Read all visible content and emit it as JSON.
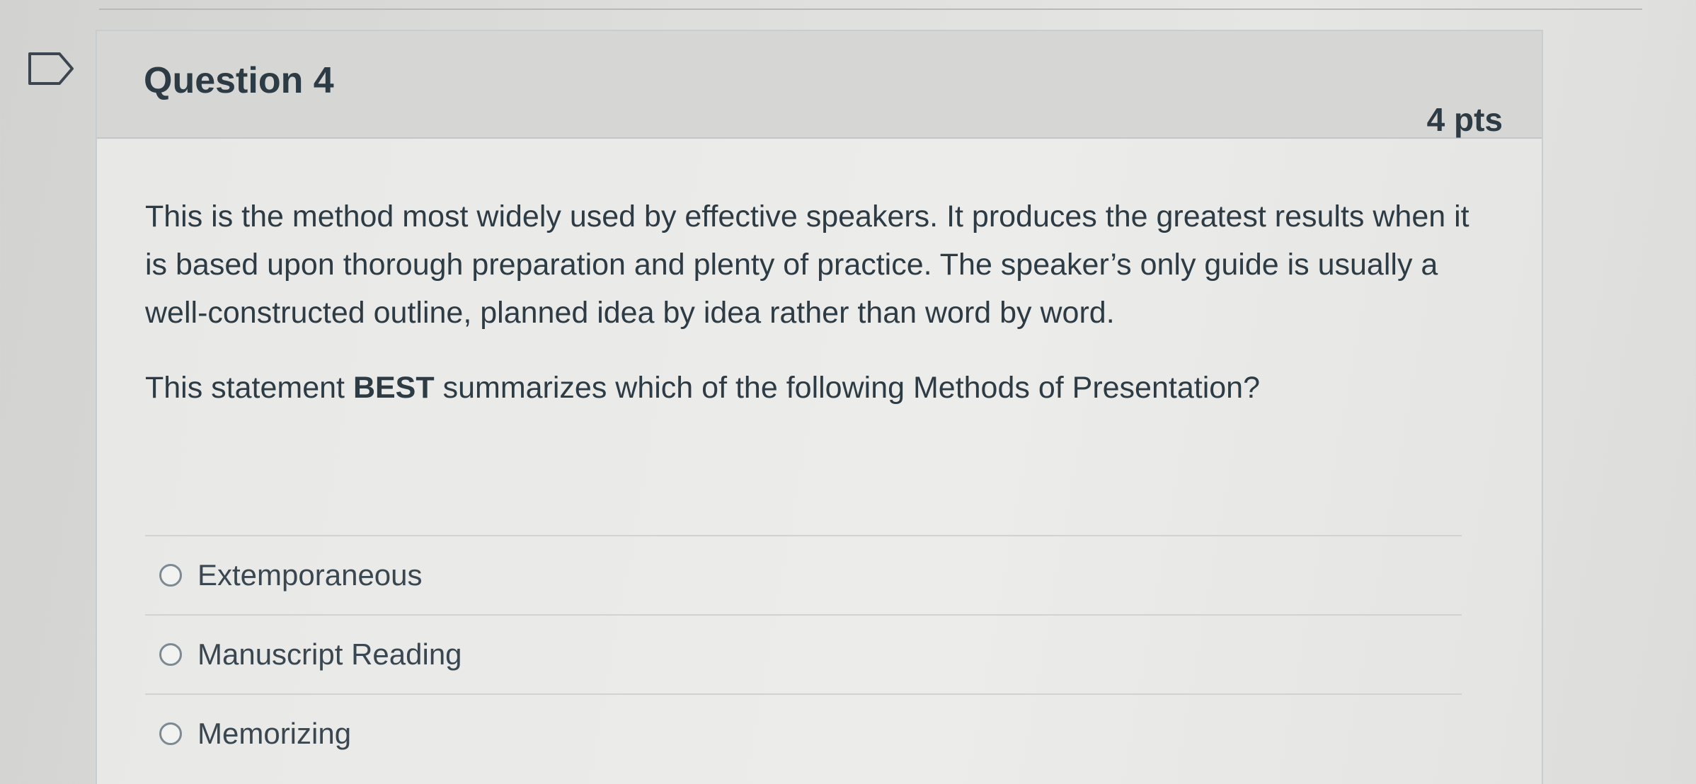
{
  "question": {
    "title": "Question 4",
    "points": "4 pts",
    "text": "This is the method most widely used by effective speakers. It produces the greatest results when it is based upon thorough preparation and plenty of practice. The speaker’s only guide is usually a well-constructed outline, planned idea by idea rather than word by word.",
    "prompt_before": "This statement ",
    "prompt_bold": "BEST",
    "prompt_after": " summarizes which of the following Methods of Presentation?"
  },
  "answers": [
    {
      "label": "Extemporaneous",
      "selected": false
    },
    {
      "label": "Manuscript Reading",
      "selected": false
    },
    {
      "label": "Memorizing",
      "selected": false
    }
  ],
  "icons": {
    "flag": "flag-question-icon"
  }
}
